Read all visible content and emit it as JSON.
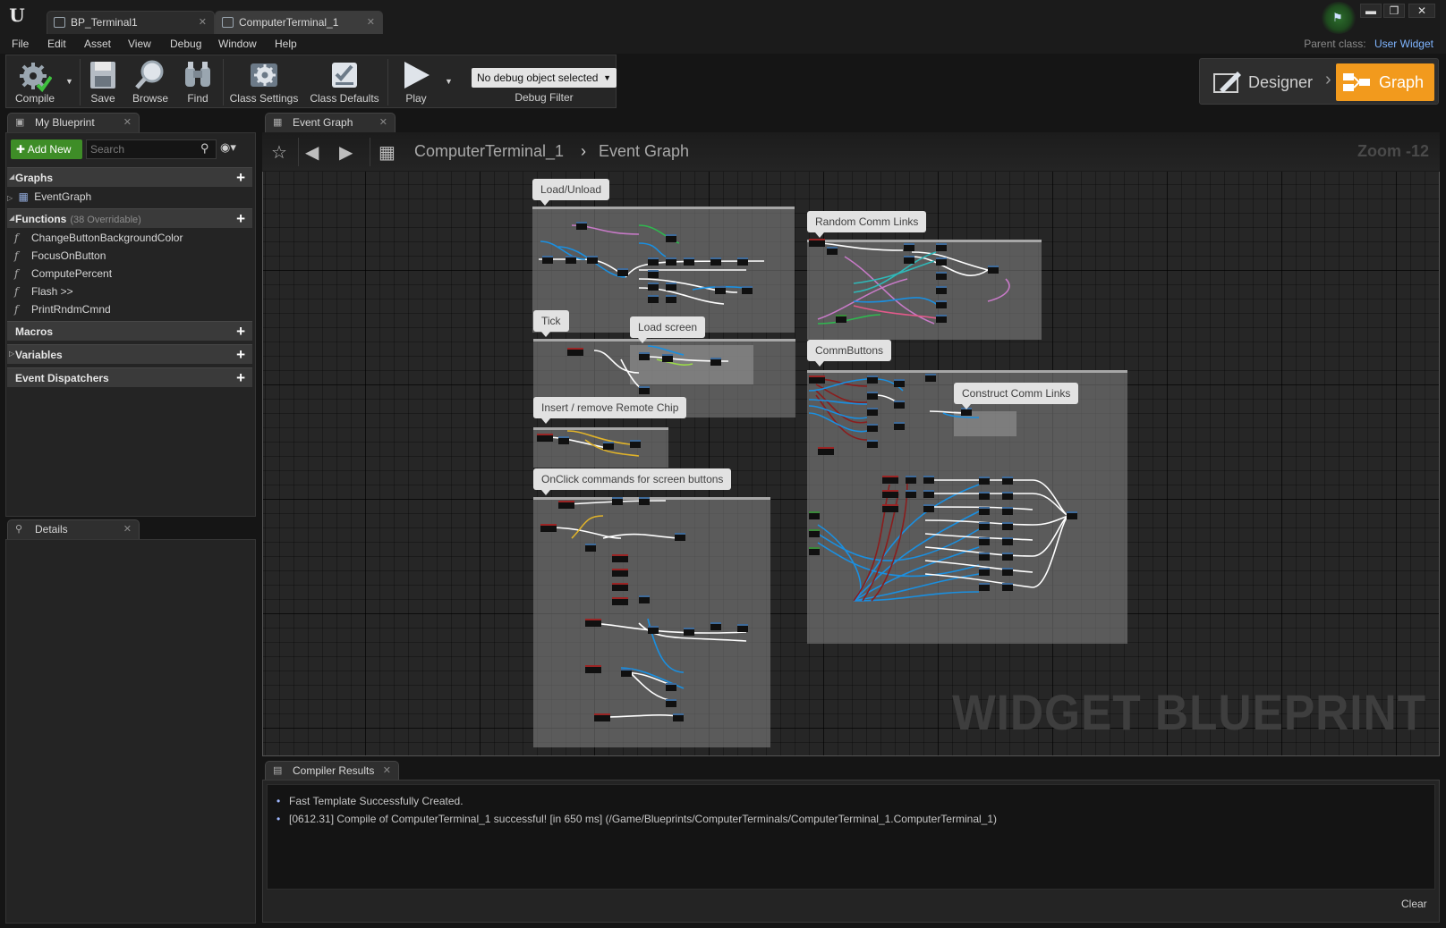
{
  "window": {
    "tabs": [
      {
        "label": "BP_Terminal1",
        "active": false
      },
      {
        "label": "ComputerTerminal_1",
        "active": true
      }
    ],
    "controls": {
      "minimize": "▬",
      "maximize": "❐",
      "close": "✕"
    }
  },
  "menu": {
    "items": [
      "File",
      "Edit",
      "Asset",
      "View",
      "Debug",
      "Window",
      "Help"
    ],
    "parent_class_label": "Parent class:",
    "parent_class_value": "User Widget"
  },
  "toolbar": {
    "compile": "Compile",
    "save": "Save",
    "browse": "Browse",
    "find": "Find",
    "class_settings": "Class Settings",
    "class_defaults": "Class Defaults",
    "play": "Play",
    "debug_object": "No debug object selected",
    "debug_filter": "Debug Filter"
  },
  "mode": {
    "designer": "Designer",
    "graph": "Graph",
    "active": "Graph",
    "active_color": "#f29a1d"
  },
  "my_blueprint": {
    "tab": "My Blueprint",
    "add_new": "Add New",
    "search_placeholder": "Search",
    "sections": {
      "graphs": "Graphs",
      "functions": "Functions",
      "functions_sub": "(38 Overridable)",
      "macros": "Macros",
      "variables": "Variables",
      "event_dispatchers": "Event Dispatchers"
    },
    "graphs": [
      "EventGraph"
    ],
    "functions": [
      "ChangeButtonBackgroundColor",
      "FocusOnButton",
      "ComputePercent",
      "Flash >>",
      "PrintRndmCmnd"
    ]
  },
  "details": {
    "tab": "Details"
  },
  "graph": {
    "tab": "Event Graph",
    "breadcrumb": [
      "ComputerTerminal_1",
      "Event Graph"
    ],
    "zoom": "Zoom -12",
    "watermark": "WIDGET BLUEPRINT",
    "comments": [
      "Load/Unload",
      "Random Comm Links",
      "Tick",
      "Load screen",
      "CommButtons",
      "Insert / remove Remote Chip",
      "Construct Comm Links",
      "OnClick commands for screen buttons"
    ]
  },
  "compiler": {
    "tab": "Compiler Results",
    "messages": [
      "Fast Template Successfully Created.",
      "[0612.31] Compile of ComputerTerminal_1 successful! [in 650 ms] (/Game/Blueprints/ComputerTerminals/ComputerTerminal_1.ComputerTerminal_1)"
    ],
    "clear": "Clear"
  },
  "colors": {
    "exec_wire": "#ffffff",
    "object_wire": "#1a8fe0",
    "struct_wire": "#8a1d1d",
    "accent_green": "#3e8d27"
  }
}
